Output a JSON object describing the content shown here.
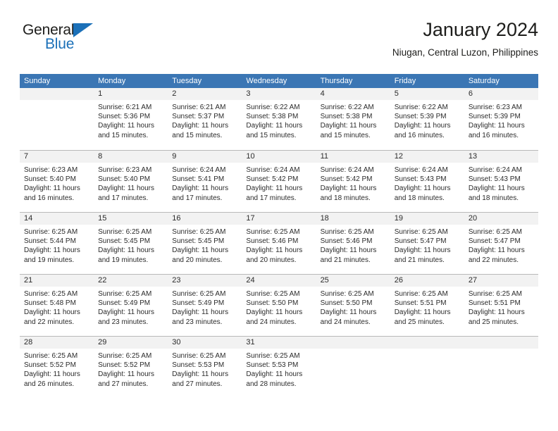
{
  "brand": {
    "name_part1": "General",
    "name_part2": "Blue",
    "triangle_icon": "blue-triangle-icon",
    "accent_color": "#1b70b8"
  },
  "header": {
    "month_title": "January 2024",
    "location": "Niugan, Central Luzon, Philippines"
  },
  "calendar": {
    "header_bg": "#3b76b4",
    "day_band_bg": "#f2f2f2",
    "weekday_names": [
      "Sunday",
      "Monday",
      "Tuesday",
      "Wednesday",
      "Thursday",
      "Friday",
      "Saturday"
    ],
    "weeks": [
      [
        {
          "day": "",
          "sunrise": "",
          "sunset": "",
          "daylight": "",
          "daylight2": "",
          "empty": true
        },
        {
          "day": "1",
          "sunrise": "Sunrise: 6:21 AM",
          "sunset": "Sunset: 5:36 PM",
          "daylight": "Daylight: 11 hours",
          "daylight2": "and 15 minutes."
        },
        {
          "day": "2",
          "sunrise": "Sunrise: 6:21 AM",
          "sunset": "Sunset: 5:37 PM",
          "daylight": "Daylight: 11 hours",
          "daylight2": "and 15 minutes."
        },
        {
          "day": "3",
          "sunrise": "Sunrise: 6:22 AM",
          "sunset": "Sunset: 5:38 PM",
          "daylight": "Daylight: 11 hours",
          "daylight2": "and 15 minutes."
        },
        {
          "day": "4",
          "sunrise": "Sunrise: 6:22 AM",
          "sunset": "Sunset: 5:38 PM",
          "daylight": "Daylight: 11 hours",
          "daylight2": "and 15 minutes."
        },
        {
          "day": "5",
          "sunrise": "Sunrise: 6:22 AM",
          "sunset": "Sunset: 5:39 PM",
          "daylight": "Daylight: 11 hours",
          "daylight2": "and 16 minutes."
        },
        {
          "day": "6",
          "sunrise": "Sunrise: 6:23 AM",
          "sunset": "Sunset: 5:39 PM",
          "daylight": "Daylight: 11 hours",
          "daylight2": "and 16 minutes."
        }
      ],
      [
        {
          "day": "7",
          "sunrise": "Sunrise: 6:23 AM",
          "sunset": "Sunset: 5:40 PM",
          "daylight": "Daylight: 11 hours",
          "daylight2": "and 16 minutes."
        },
        {
          "day": "8",
          "sunrise": "Sunrise: 6:23 AM",
          "sunset": "Sunset: 5:40 PM",
          "daylight": "Daylight: 11 hours",
          "daylight2": "and 17 minutes."
        },
        {
          "day": "9",
          "sunrise": "Sunrise: 6:24 AM",
          "sunset": "Sunset: 5:41 PM",
          "daylight": "Daylight: 11 hours",
          "daylight2": "and 17 minutes."
        },
        {
          "day": "10",
          "sunrise": "Sunrise: 6:24 AM",
          "sunset": "Sunset: 5:42 PM",
          "daylight": "Daylight: 11 hours",
          "daylight2": "and 17 minutes."
        },
        {
          "day": "11",
          "sunrise": "Sunrise: 6:24 AM",
          "sunset": "Sunset: 5:42 PM",
          "daylight": "Daylight: 11 hours",
          "daylight2": "and 18 minutes."
        },
        {
          "day": "12",
          "sunrise": "Sunrise: 6:24 AM",
          "sunset": "Sunset: 5:43 PM",
          "daylight": "Daylight: 11 hours",
          "daylight2": "and 18 minutes."
        },
        {
          "day": "13",
          "sunrise": "Sunrise: 6:24 AM",
          "sunset": "Sunset: 5:43 PM",
          "daylight": "Daylight: 11 hours",
          "daylight2": "and 18 minutes."
        }
      ],
      [
        {
          "day": "14",
          "sunrise": "Sunrise: 6:25 AM",
          "sunset": "Sunset: 5:44 PM",
          "daylight": "Daylight: 11 hours",
          "daylight2": "and 19 minutes."
        },
        {
          "day": "15",
          "sunrise": "Sunrise: 6:25 AM",
          "sunset": "Sunset: 5:45 PM",
          "daylight": "Daylight: 11 hours",
          "daylight2": "and 19 minutes."
        },
        {
          "day": "16",
          "sunrise": "Sunrise: 6:25 AM",
          "sunset": "Sunset: 5:45 PM",
          "daylight": "Daylight: 11 hours",
          "daylight2": "and 20 minutes."
        },
        {
          "day": "17",
          "sunrise": "Sunrise: 6:25 AM",
          "sunset": "Sunset: 5:46 PM",
          "daylight": "Daylight: 11 hours",
          "daylight2": "and 20 minutes."
        },
        {
          "day": "18",
          "sunrise": "Sunrise: 6:25 AM",
          "sunset": "Sunset: 5:46 PM",
          "daylight": "Daylight: 11 hours",
          "daylight2": "and 21 minutes."
        },
        {
          "day": "19",
          "sunrise": "Sunrise: 6:25 AM",
          "sunset": "Sunset: 5:47 PM",
          "daylight": "Daylight: 11 hours",
          "daylight2": "and 21 minutes."
        },
        {
          "day": "20",
          "sunrise": "Sunrise: 6:25 AM",
          "sunset": "Sunset: 5:47 PM",
          "daylight": "Daylight: 11 hours",
          "daylight2": "and 22 minutes."
        }
      ],
      [
        {
          "day": "21",
          "sunrise": "Sunrise: 6:25 AM",
          "sunset": "Sunset: 5:48 PM",
          "daylight": "Daylight: 11 hours",
          "daylight2": "and 22 minutes."
        },
        {
          "day": "22",
          "sunrise": "Sunrise: 6:25 AM",
          "sunset": "Sunset: 5:49 PM",
          "daylight": "Daylight: 11 hours",
          "daylight2": "and 23 minutes."
        },
        {
          "day": "23",
          "sunrise": "Sunrise: 6:25 AM",
          "sunset": "Sunset: 5:49 PM",
          "daylight": "Daylight: 11 hours",
          "daylight2": "and 23 minutes."
        },
        {
          "day": "24",
          "sunrise": "Sunrise: 6:25 AM",
          "sunset": "Sunset: 5:50 PM",
          "daylight": "Daylight: 11 hours",
          "daylight2": "and 24 minutes."
        },
        {
          "day": "25",
          "sunrise": "Sunrise: 6:25 AM",
          "sunset": "Sunset: 5:50 PM",
          "daylight": "Daylight: 11 hours",
          "daylight2": "and 24 minutes."
        },
        {
          "day": "26",
          "sunrise": "Sunrise: 6:25 AM",
          "sunset": "Sunset: 5:51 PM",
          "daylight": "Daylight: 11 hours",
          "daylight2": "and 25 minutes."
        },
        {
          "day": "27",
          "sunrise": "Sunrise: 6:25 AM",
          "sunset": "Sunset: 5:51 PM",
          "daylight": "Daylight: 11 hours",
          "daylight2": "and 25 minutes."
        }
      ],
      [
        {
          "day": "28",
          "sunrise": "Sunrise: 6:25 AM",
          "sunset": "Sunset: 5:52 PM",
          "daylight": "Daylight: 11 hours",
          "daylight2": "and 26 minutes."
        },
        {
          "day": "29",
          "sunrise": "Sunrise: 6:25 AM",
          "sunset": "Sunset: 5:52 PM",
          "daylight": "Daylight: 11 hours",
          "daylight2": "and 27 minutes."
        },
        {
          "day": "30",
          "sunrise": "Sunrise: 6:25 AM",
          "sunset": "Sunset: 5:53 PM",
          "daylight": "Daylight: 11 hours",
          "daylight2": "and 27 minutes."
        },
        {
          "day": "31",
          "sunrise": "Sunrise: 6:25 AM",
          "sunset": "Sunset: 5:53 PM",
          "daylight": "Daylight: 11 hours",
          "daylight2": "and 28 minutes."
        },
        {
          "day": "",
          "sunrise": "",
          "sunset": "",
          "daylight": "",
          "daylight2": "",
          "empty": true
        },
        {
          "day": "",
          "sunrise": "",
          "sunset": "",
          "daylight": "",
          "daylight2": "",
          "empty": true
        },
        {
          "day": "",
          "sunrise": "",
          "sunset": "",
          "daylight": "",
          "daylight2": "",
          "empty": true
        }
      ]
    ]
  }
}
